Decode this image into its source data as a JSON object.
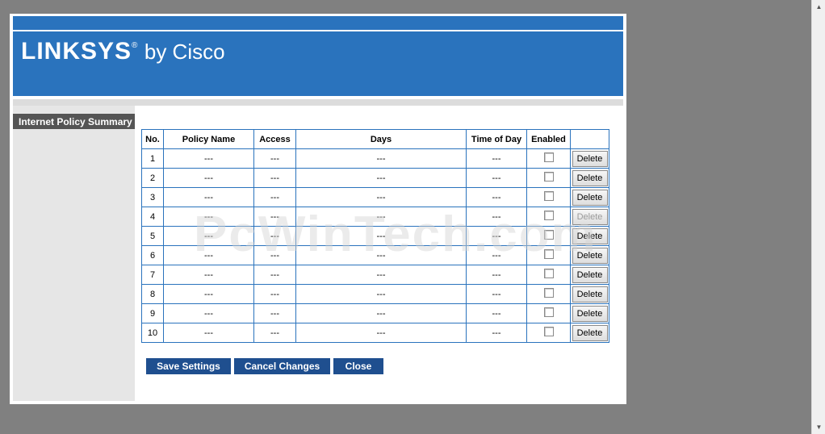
{
  "header": {
    "brand": "LINKSYS",
    "registered": "®",
    "by_cisco": "by Cisco"
  },
  "section_label": "Internet Policy Summary",
  "table": {
    "columns": [
      "No.",
      "Policy Name",
      "Access",
      "Days",
      "Time of Day",
      "Enabled",
      ""
    ],
    "rows": [
      {
        "no": "1",
        "name": "---",
        "access": "---",
        "days": "---",
        "time": "---",
        "enabled": false,
        "delete": "Delete"
      },
      {
        "no": "2",
        "name": "---",
        "access": "---",
        "days": "---",
        "time": "---",
        "enabled": false,
        "delete": "Delete"
      },
      {
        "no": "3",
        "name": "---",
        "access": "---",
        "days": "---",
        "time": "---",
        "enabled": false,
        "delete": "Delete"
      },
      {
        "no": "4",
        "name": "---",
        "access": "---",
        "days": "---",
        "time": "---",
        "enabled": false,
        "delete": "Delete"
      },
      {
        "no": "5",
        "name": "---",
        "access": "---",
        "days": "---",
        "time": "---",
        "enabled": false,
        "delete": "Delete"
      },
      {
        "no": "6",
        "name": "---",
        "access": "---",
        "days": "---",
        "time": "---",
        "enabled": false,
        "delete": "Delete"
      },
      {
        "no": "7",
        "name": "---",
        "access": "---",
        "days": "---",
        "time": "---",
        "enabled": false,
        "delete": "Delete"
      },
      {
        "no": "8",
        "name": "---",
        "access": "---",
        "days": "---",
        "time": "---",
        "enabled": false,
        "delete": "Delete"
      },
      {
        "no": "9",
        "name": "---",
        "access": "---",
        "days": "---",
        "time": "---",
        "enabled": false,
        "delete": "Delete"
      },
      {
        "no": "10",
        "name": "---",
        "access": "---",
        "days": "---",
        "time": "---",
        "enabled": false,
        "delete": "Delete"
      }
    ]
  },
  "actions": {
    "save": "Save Settings",
    "cancel": "Cancel Changes",
    "close": "Close"
  },
  "watermark": "PcWinTech.com",
  "colors": {
    "brand_blue": "#2a73bd",
    "button_blue": "#1f4f8f",
    "backdrop": "#808080"
  }
}
